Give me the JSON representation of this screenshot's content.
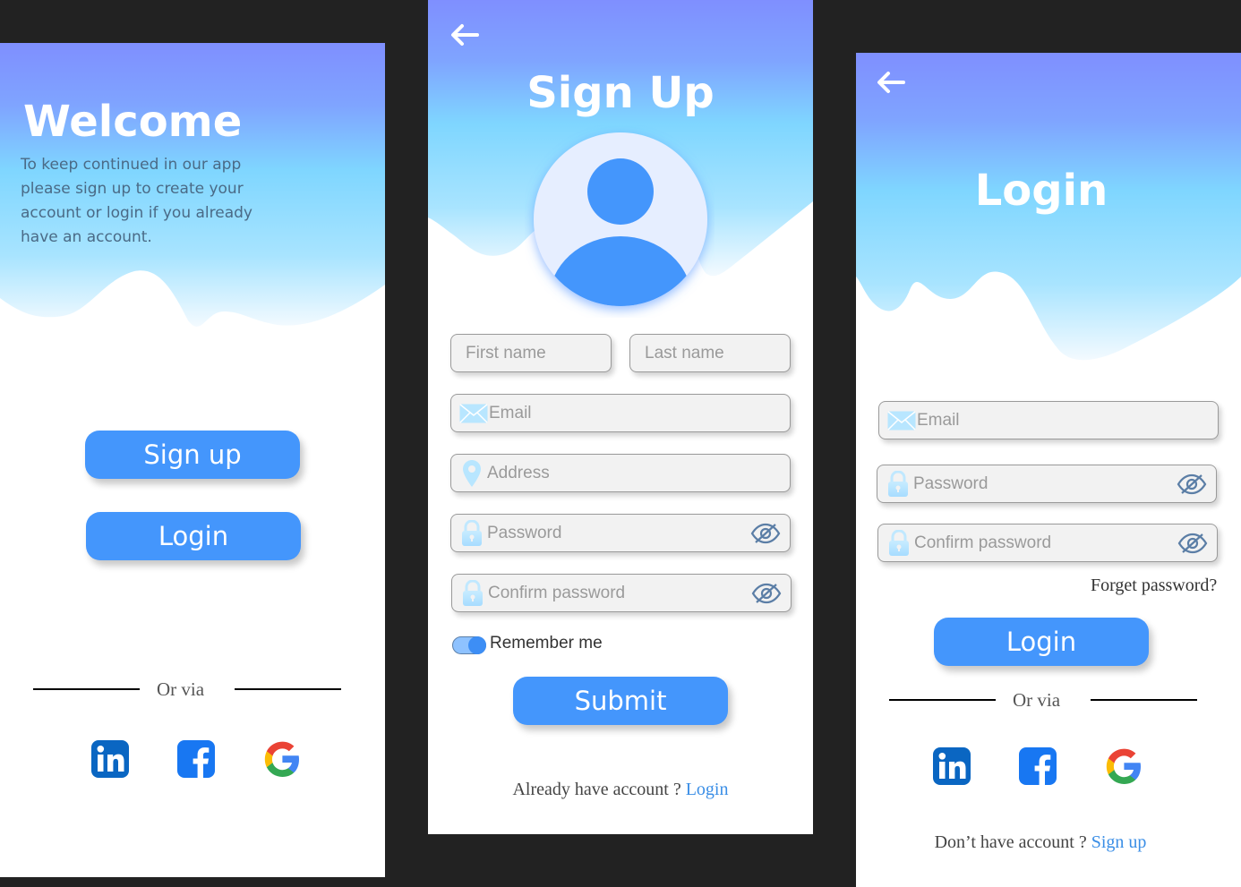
{
  "welcome": {
    "title": "Welcome",
    "description": "To keep continued in our app please  sign up to create your account or login if you already have an account.",
    "signup_label": "Sign up",
    "login_label": "Login",
    "or_via": "Or via"
  },
  "signup": {
    "title": "Sign Up",
    "first_name_placeholder": "First name",
    "last_name_placeholder": "Last name",
    "email_placeholder": "Email",
    "address_placeholder": "Address",
    "password_placeholder": "Password",
    "confirm_placeholder": "Confirm password",
    "remember_label": "Remember me",
    "remember_on": true,
    "submit_label": "Submit",
    "footer_text": "Already have account ?",
    "footer_link": "Login"
  },
  "login": {
    "title": "Login",
    "email_placeholder": "Email",
    "password_placeholder": "Password",
    "confirm_placeholder": "Confirm password",
    "forget_label": "Forget password?",
    "login_label": "Login",
    "or_via": "Or via",
    "footer_text": "Don’t have account ?",
    "footer_link": "Sign up"
  },
  "social_icons": [
    "linkedin-icon",
    "facebook-icon",
    "google-icon"
  ],
  "colors": {
    "background": "#222222",
    "accent": "#4496fc",
    "gradient_top": "#7f93ff",
    "gradient_mid": "#7fd4ff",
    "gradient_bottom": "#e8f6ff",
    "link": "#3a8ee6"
  }
}
